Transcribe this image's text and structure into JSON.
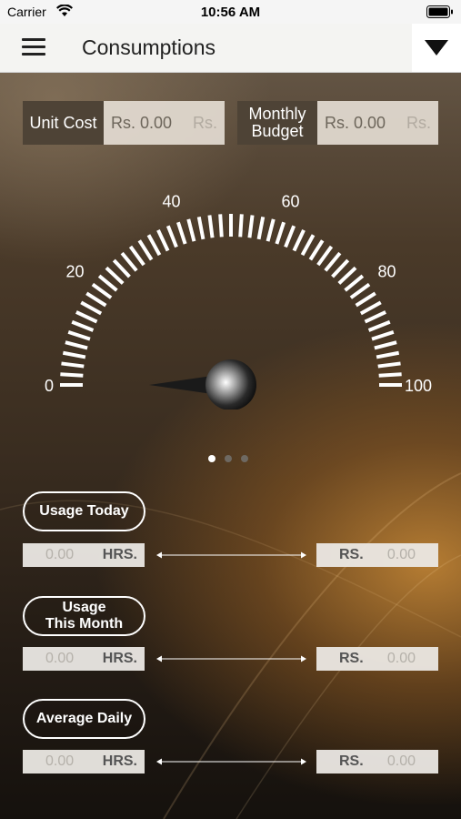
{
  "status_bar": {
    "carrier": "Carrier",
    "time": "10:56 AM"
  },
  "header": {
    "title": "Consumptions",
    "menu_icon": "hamburger-menu-icon",
    "dropdown_icon": "triangle-down-icon"
  },
  "unit_cost": {
    "label": "Unit Cost",
    "value": "Rs. 0.00",
    "unit": "Rs."
  },
  "monthly_budget": {
    "label_line1": "Monthly",
    "label_line2": "Budget",
    "value": "Rs. 0.00",
    "unit": "Rs."
  },
  "gauge": {
    "min": 0,
    "max": 100,
    "value": 0,
    "ticks": [
      "0",
      "20",
      "40",
      "60",
      "80",
      "100"
    ]
  },
  "pager": {
    "pages": 3,
    "active": 0
  },
  "usage_today": {
    "label": "Usage Today",
    "hours_value": "0.00",
    "hours_label": "HRS.",
    "rs_label": "RS.",
    "rs_value": "0.00"
  },
  "usage_month": {
    "label_line1": "Usage",
    "label_line2": "This Month",
    "hours_value": "0.00",
    "hours_label": "HRS.",
    "rs_label": "RS.",
    "rs_value": "0.00"
  },
  "average_daily": {
    "label": "Average Daily",
    "hours_value": "0.00",
    "hours_label": "HRS.",
    "rs_label": "RS.",
    "rs_value": "0.00"
  },
  "colors": {
    "label_bg": "#4e4336",
    "field_bg": "#e4dcd2",
    "accent_glow": "#cd8c37"
  }
}
